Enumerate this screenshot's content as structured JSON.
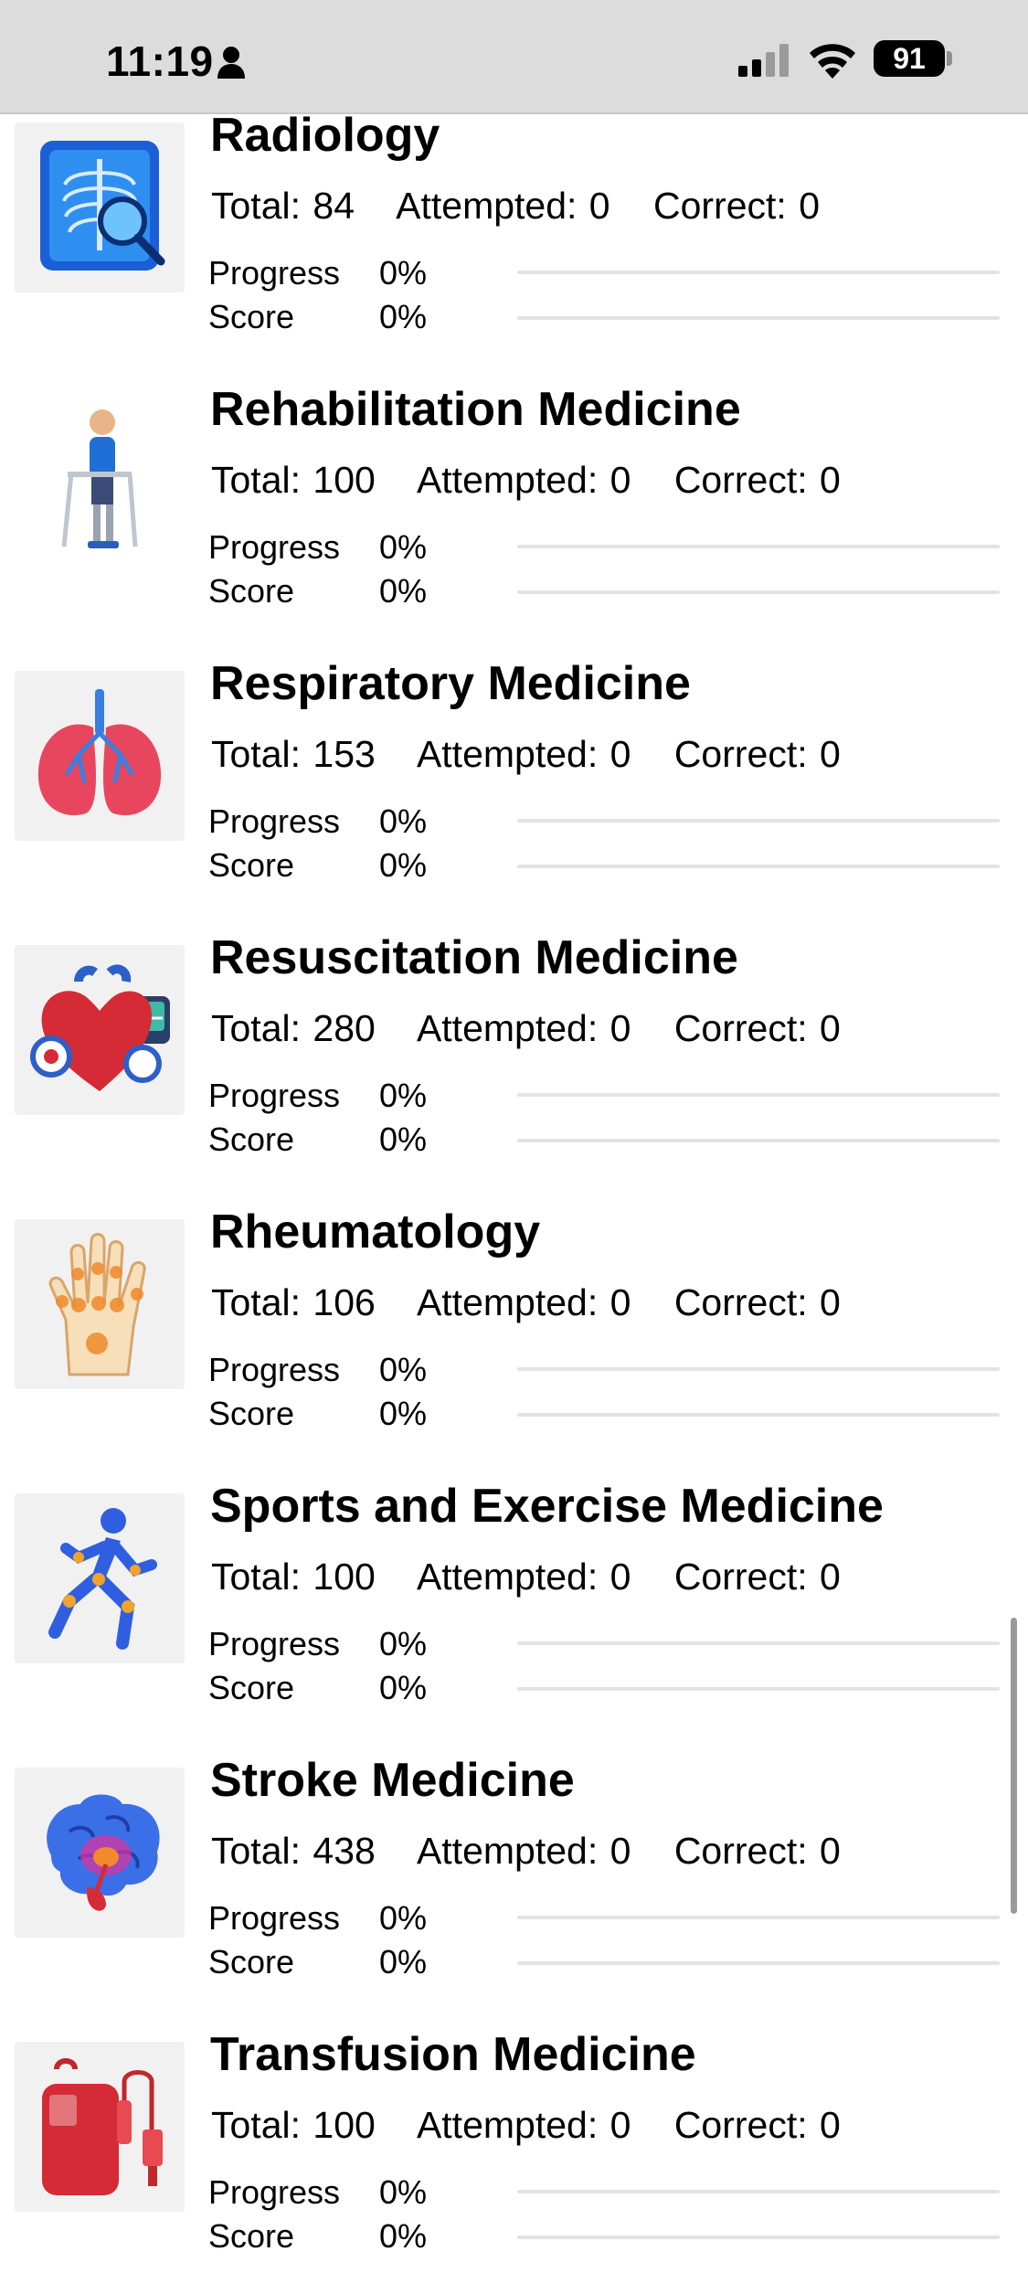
{
  "status_bar": {
    "time": "11:19",
    "battery": "91"
  },
  "labels": {
    "progress": "Progress",
    "score": "Score"
  },
  "items": [
    {
      "title": "Radiology",
      "total": "Total: 84",
      "attempted": "Attempted: 0",
      "correct": "Correct: 0",
      "progress": "0%",
      "score": "0%",
      "progress_value": 0,
      "score_value": 0,
      "icon": "xray-chest-magnifier-icon"
    },
    {
      "title": "Rehabilitation Medicine",
      "total": "Total: 100",
      "attempted": "Attempted: 0",
      "correct": "Correct: 0",
      "progress": "0%",
      "score": "0%",
      "progress_value": 0,
      "score_value": 0,
      "icon": "walker-rehab-icon"
    },
    {
      "title": "Respiratory Medicine",
      "total": "Total: 153",
      "attempted": "Attempted: 0",
      "correct": "Correct: 0",
      "progress": "0%",
      "score": "0%",
      "progress_value": 0,
      "score_value": 0,
      "icon": "lungs-icon"
    },
    {
      "title": "Resuscitation Medicine",
      "total": "Total: 280",
      "attempted": "Attempted: 0",
      "correct": "Correct: 0",
      "progress": "0%",
      "score": "0%",
      "progress_value": 0,
      "score_value": 0,
      "icon": "heart-defibrillator-icon"
    },
    {
      "title": "Rheumatology",
      "total": "Total: 106",
      "attempted": "Attempted: 0",
      "correct": "Correct: 0",
      "progress": "0%",
      "score": "0%",
      "progress_value": 0,
      "score_value": 0,
      "icon": "hand-joints-icon"
    },
    {
      "title": "Sports and Exercise Medicine",
      "total": "Total: 100",
      "attempted": "Attempted: 0",
      "correct": "Correct: 0",
      "progress": "0%",
      "score": "0%",
      "progress_value": 0,
      "score_value": 0,
      "icon": "runner-icon"
    },
    {
      "title": "Stroke Medicine",
      "total": "Total: 438",
      "attempted": "Attempted: 0",
      "correct": "Correct: 0",
      "progress": "0%",
      "score": "0%",
      "progress_value": 0,
      "score_value": 0,
      "icon": "brain-icon"
    },
    {
      "title": "Transfusion Medicine",
      "total": "Total: 100",
      "attempted": "Attempted: 0",
      "correct": "Correct: 0",
      "progress": "0%",
      "score": "0%",
      "progress_value": 0,
      "score_value": 0,
      "icon": "blood-bag-icon"
    }
  ]
}
